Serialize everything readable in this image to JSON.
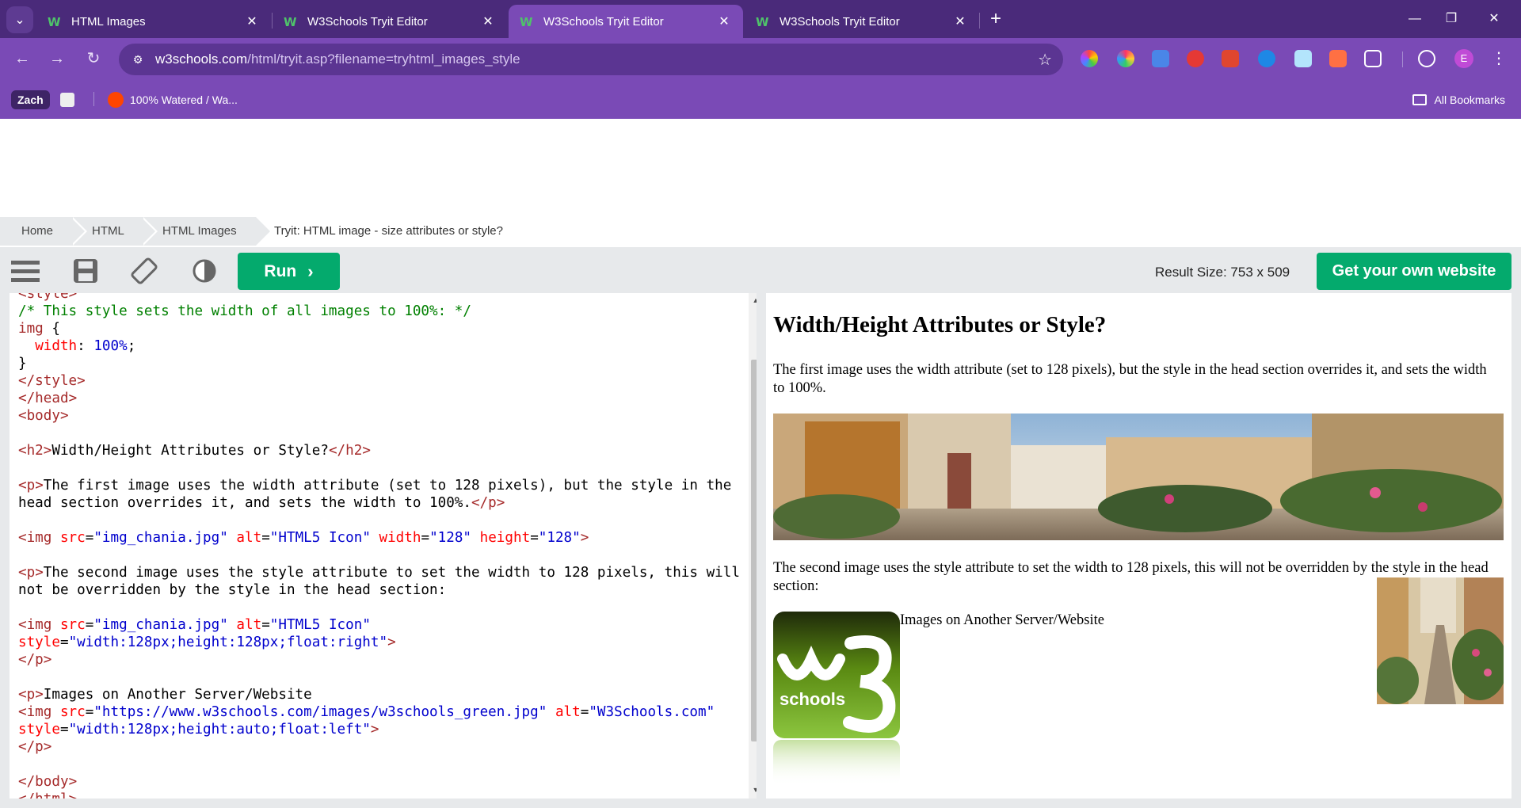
{
  "browser": {
    "tabs": [
      {
        "title": "HTML Images",
        "active": false
      },
      {
        "title": "W3Schools Tryit Editor",
        "active": false
      },
      {
        "title": "W3Schools Tryit Editor",
        "active": true
      },
      {
        "title": "W3Schools Tryit Editor",
        "active": false
      }
    ],
    "url_host": "w3schools.com",
    "url_path": "/html/tryit.asp?filename=tryhtml_images_style",
    "profile_initial": "E",
    "bookmarks": {
      "profile_chip": "Zach",
      "reddit_item": "100% Watered / Wa...",
      "all_bookmarks": "All Bookmarks"
    }
  },
  "breadcrumb": {
    "items": [
      "Home",
      "HTML",
      "HTML Images"
    ],
    "current": "Tryit: HTML image - size attributes or style?"
  },
  "editor_bar": {
    "run_label": "Run",
    "result_size": "Result Size: 753 x 509",
    "get_website_label": "Get your own website"
  },
  "code": {
    "lines": [
      "<style>",
      "/* This style sets the width of all images to 100%: */",
      "img {",
      "  width: 100%;",
      "}",
      "</style>",
      "</head>",
      "<body>",
      "",
      "<h2>Width/Height Attributes or Style?</h2>",
      "",
      "<p>The first image uses the width attribute (set to 128 pixels), but the style in the",
      "head section overrides it, and sets the width to 100%.</p>",
      "",
      "<img src=\"img_chania.jpg\" alt=\"HTML5 Icon\" width=\"128\" height=\"128\">",
      "",
      "<p>The second image uses the style attribute to set the width to 128 pixels, this will",
      "not be overridden by the style in the head section:",
      "",
      "<img src=\"img_chania.jpg\" alt=\"HTML5 Icon\"",
      "style=\"width:128px;height:128px;float:right\">",
      "</p>",
      "",
      "<p>Images on Another Server/Website",
      "<img src=\"https://www.w3schools.com/images/w3schools_green.jpg\" alt=\"W3Schools.com\"",
      "style=\"width:128px;height:auto;float:left\">",
      "</p>",
      "",
      "</body>",
      "</html>"
    ]
  },
  "result": {
    "heading": "Width/Height Attributes or Style?",
    "p1": "The first image uses the width attribute (set to 128 pixels), but the style in the head section overrides it, and sets the width to 100%.",
    "p2": "The second image uses the style attribute to set the width to 128 pixels, this will not be overridden by the style in the head section:",
    "p3": "Images on Another Server/Website",
    "w3_logo_text": "schools"
  },
  "colors": {
    "tab_strip": "#4a2a7a",
    "toolbar": "#7a4ab6",
    "w3_green": "#04aa6d"
  }
}
